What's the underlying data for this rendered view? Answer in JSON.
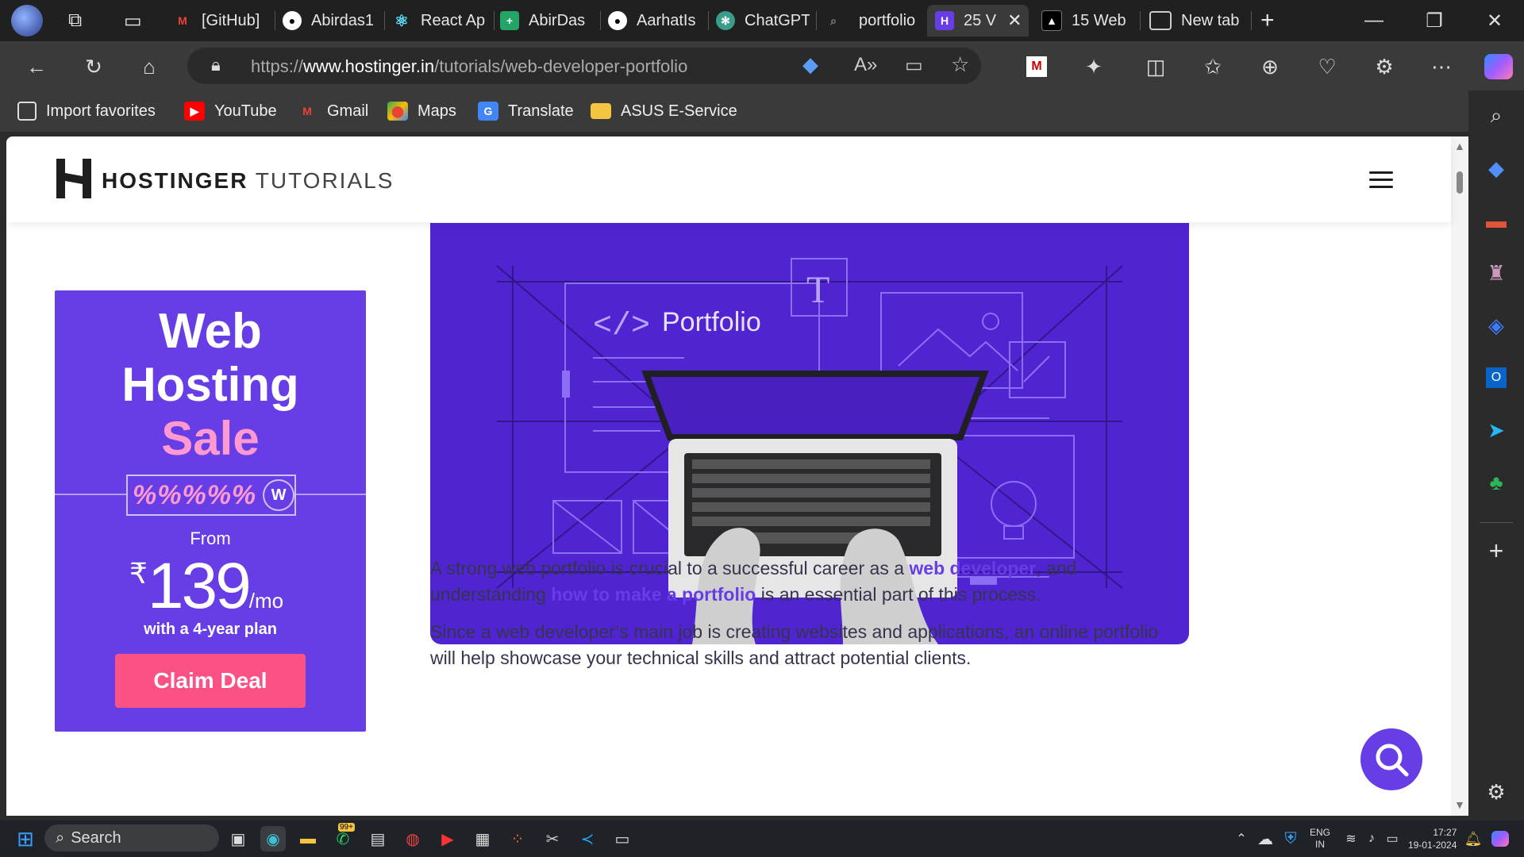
{
  "tabs": [
    {
      "label": "",
      "favicon": "profile-avatar"
    },
    {
      "label": "",
      "favicon": "workspaces-icon"
    },
    {
      "label": "",
      "favicon": "tab-actions-icon"
    },
    {
      "label": "[GitHub]",
      "favicon": "gmail-icon"
    },
    {
      "label": "Abirdas1",
      "favicon": "github-icon"
    },
    {
      "label": "React Ap",
      "favicon": "react-icon"
    },
    {
      "label": "AbirDas",
      "favicon": "sheets-icon"
    },
    {
      "label": "AarhatIs",
      "favicon": "github-icon"
    },
    {
      "label": "ChatGPT",
      "favicon": "chatgpt-icon"
    },
    {
      "label": "portfolio",
      "favicon": "search-icon"
    },
    {
      "label": "25 V",
      "favicon": "hostinger-icon"
    },
    {
      "label": "15 Web",
      "favicon": "vercel-icon"
    },
    {
      "label": "New tab",
      "favicon": "newtab-icon"
    }
  ],
  "address": {
    "prefix": "https://",
    "domain": "www.hostinger.in",
    "path": "/tutorials/web-developer-portfolio"
  },
  "favorites": [
    {
      "label": "Import favorites",
      "icon": "import-icon"
    },
    {
      "label": "YouTube",
      "icon": "youtube-icon"
    },
    {
      "label": "Gmail",
      "icon": "gmail-icon"
    },
    {
      "label": "Maps",
      "icon": "maps-icon"
    },
    {
      "label": "Translate",
      "icon": "translate-icon"
    },
    {
      "label": "ASUS E-Service",
      "icon": "folder-icon"
    }
  ],
  "site": {
    "brand_bold": "HOSTINGER",
    "brand_light": "TUTORIALS"
  },
  "ad": {
    "line1": "Web",
    "line2": "Hosting",
    "line3": "Sale",
    "percents": "%%%%%",
    "from": "From",
    "currency": "₹",
    "price": "139",
    "per": "/mo",
    "plan": "with a 4-year plan",
    "cta": "Claim Deal"
  },
  "hero": {
    "title": "Portfolio",
    "code_glyph": "</>",
    "text_tool": "T"
  },
  "article": {
    "p1_a": "A strong web portfolio is crucial to a successful career as a ",
    "p1_link1": "web developer",
    "p1_b": ", and understanding ",
    "p1_link2": "how to make a portfolio",
    "p1_c": " is an essential part of this process.",
    "p2": "Since a web developer’s main job is creating websites and applications, an online portfolio will help showcase your technical skills and attract potential clients."
  },
  "taskbar": {
    "search": "Search",
    "lang1": "ENG",
    "lang2": "IN",
    "time": "17:27",
    "date": "19-01-2024",
    "whatsapp_badge": "99+"
  },
  "colors": {
    "brand_purple": "#673de6",
    "hero_purple": "#5025d1",
    "cta_pink": "#fc5185"
  }
}
